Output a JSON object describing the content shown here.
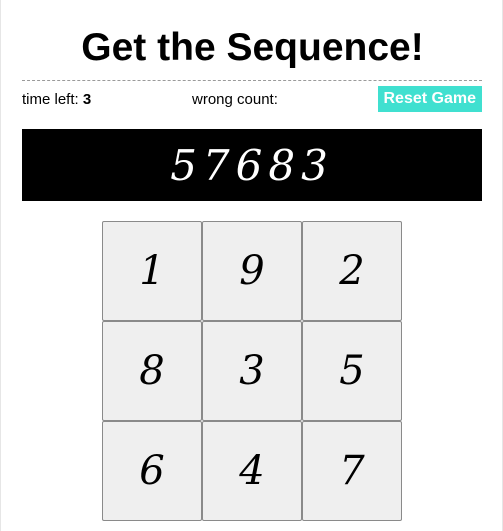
{
  "title": "Get the Sequence!",
  "status": {
    "time_left_label": "time left:",
    "time_left_value": "3",
    "wrong_count_label": "wrong count:",
    "wrong_count_value": ""
  },
  "reset_button": "Reset Game",
  "sequence": "57683",
  "keypad": [
    "1",
    "9",
    "2",
    "8",
    "3",
    "5",
    "6",
    "4",
    "7"
  ],
  "colors": {
    "accent": "#40e0d0",
    "sequence_bg": "#000000",
    "key_bg": "#efefef"
  }
}
